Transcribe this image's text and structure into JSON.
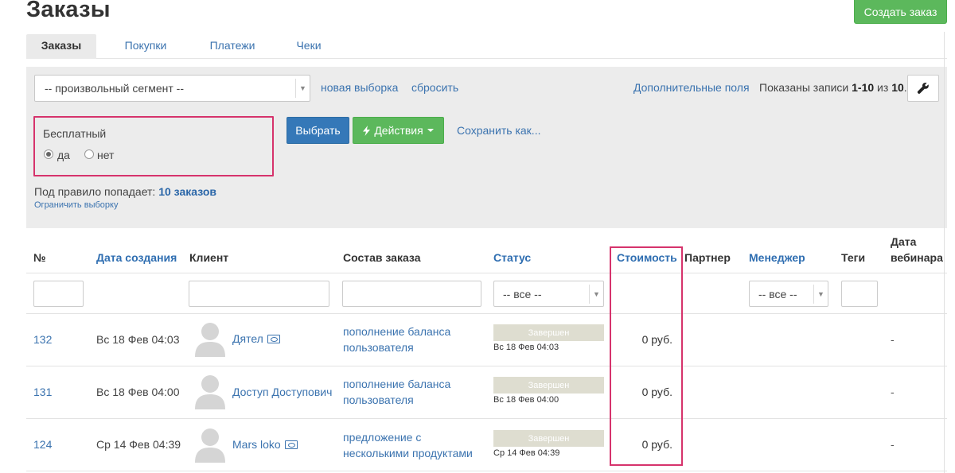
{
  "header": {
    "title": "Заказы",
    "create_button": "Создать заказ"
  },
  "tabs": [
    {
      "label": "Заказы",
      "active": true
    },
    {
      "label": "Покупки",
      "active": false
    },
    {
      "label": "Платежи",
      "active": false
    },
    {
      "label": "Чеки",
      "active": false
    }
  ],
  "filters": {
    "segment_value": "-- произвольный сегмент --",
    "new_selection": "новая выборка",
    "reset": "сбросить",
    "extra_fields": "Дополнительные поля",
    "shown_prefix": "Показаны записи ",
    "shown_range": "1-10",
    "shown_mid": " из ",
    "shown_total": "10",
    "shown_suffix": ".",
    "condition_label": "Бесплатный",
    "radio_yes": "да",
    "radio_no": "нет",
    "radio_selected": "да",
    "select_button": "Выбрать",
    "actions_button": "Действия",
    "save_as": "Сохранить как...",
    "rule_prefix": "Под правило попадает: ",
    "rule_count": "10 заказов",
    "limit_link": "Ограничить выборку"
  },
  "table": {
    "headers": {
      "num": "№",
      "created": "Дата создания",
      "client": "Клиент",
      "composition": "Состав заказа",
      "status": "Статус",
      "cost": "Стоимость",
      "partner": "Партнер",
      "manager": "Менеджер",
      "tags": "Теги",
      "webinar_date_1": "Дата",
      "webinar_date_2": "вебинара"
    },
    "status_filter": "-- все --",
    "manager_filter": "-- все --",
    "rows": [
      {
        "num": "132",
        "created": "Вс 18 Фев 04:03",
        "client": "Дятел",
        "client_has_card": true,
        "composition_1": "пополнение баланса",
        "composition_2": "пользователя",
        "status": "Завершен",
        "status_date": "Вс 18 Фев 04:03",
        "cost": "0 руб.",
        "webinar_date": "-"
      },
      {
        "num": "131",
        "created": "Вс 18 Фев 04:00",
        "client": "Доступ Доступович",
        "client_has_card": false,
        "composition_1": "пополнение баланса",
        "composition_2": "пользователя",
        "status": "Завершен",
        "status_date": "Вс 18 Фев 04:00",
        "cost": "0 руб.",
        "webinar_date": "-"
      },
      {
        "num": "124",
        "created": "Ср 14 Фев 04:39",
        "client": "Mars loko",
        "client_has_card": true,
        "composition_1": "предложение с",
        "composition_2": "несколькими продуктами",
        "status": "Завершен",
        "status_date": "Ср 14 Фев 04:39",
        "cost": "0 руб.",
        "webinar_date": "-"
      }
    ]
  },
  "colors": {
    "accent_blue": "#3b73af",
    "primary_button": "#3578b8",
    "success_button": "#5cb85c",
    "highlight_border": "#d6336c",
    "status_badge": "#deddd0"
  }
}
